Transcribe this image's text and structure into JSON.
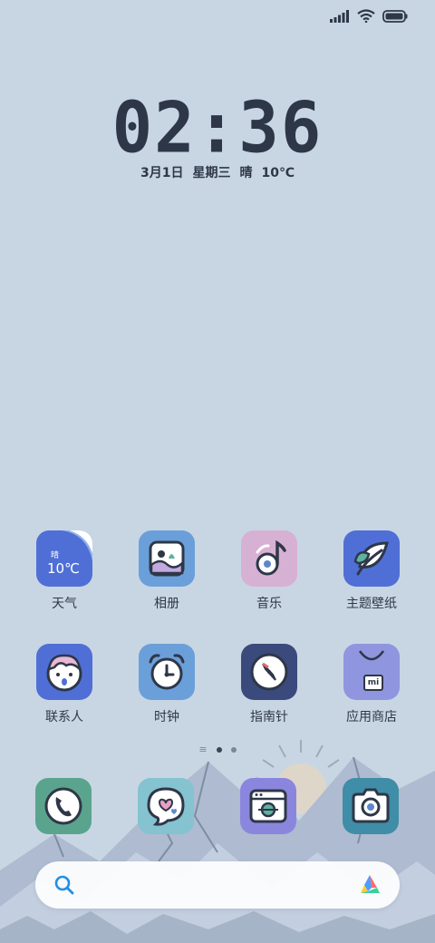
{
  "status_bar": {
    "icons": [
      "signal-icon",
      "wifi-icon",
      "battery-icon"
    ]
  },
  "clock": {
    "time": "02:36"
  },
  "date": {
    "date": "3月1日",
    "weekday": "星期三",
    "weather": "晴",
    "temp": "10℃"
  },
  "apps_row1": [
    {
      "label": "天气",
      "icon": "weather-icon",
      "tile_text_top": "晴",
      "tile_text_temp": "10℃",
      "color": "#4f6fd6"
    },
    {
      "label": "相册",
      "icon": "gallery-icon",
      "color": "#6b9fd9"
    },
    {
      "label": "音乐",
      "icon": "music-icon",
      "color": "#d7b1d3"
    },
    {
      "label": "主题壁纸",
      "icon": "leaf-icon",
      "color": "#4f6fd6"
    }
  ],
  "apps_row2": [
    {
      "label": "联系人",
      "icon": "contacts-icon",
      "color": "#4f6fd6"
    },
    {
      "label": "时钟",
      "icon": "alarm-clock-icon",
      "color": "#6b9fd9"
    },
    {
      "label": "指南针",
      "icon": "compass-icon",
      "color": "#3b4a7c"
    },
    {
      "label": "应用商店",
      "icon": "shopping-bag-icon",
      "tile_text": "mi",
      "color": "#8f95de"
    }
  ],
  "dock": [
    {
      "icon": "phone-icon",
      "color": "#5aa48d"
    },
    {
      "icon": "message-heart-icon",
      "color": "#84c3cf"
    },
    {
      "icon": "browser-icon",
      "color": "#8b86dd"
    },
    {
      "icon": "camera-icon",
      "color": "#3f8da6"
    }
  ],
  "search": {
    "icon": "search-icon",
    "assistant_icon": "assistant-logo-icon"
  }
}
